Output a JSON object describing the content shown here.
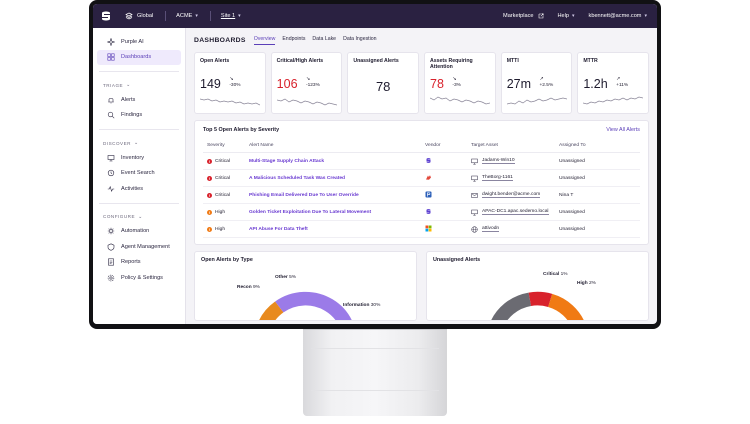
{
  "topbar": {
    "scope": "Global",
    "account": "ACME",
    "site": "Site 1",
    "marketplace": "Marketplace",
    "help": "Help",
    "user": "kbennett@acme.com"
  },
  "sidebar": {
    "items_top": [
      {
        "label": "Purple AI",
        "icon": "sparkle-icon"
      },
      {
        "label": "Dashboards",
        "icon": "dashboard-icon",
        "active": true
      }
    ],
    "sections": [
      {
        "title": "TRIAGE",
        "items": [
          {
            "label": "Alerts",
            "icon": "bell-icon"
          },
          {
            "label": "Findings",
            "icon": "findings-icon"
          }
        ]
      },
      {
        "title": "DISCOVER",
        "items": [
          {
            "label": "Inventory",
            "icon": "inventory-icon"
          },
          {
            "label": "Event Search",
            "icon": "search-icon"
          },
          {
            "label": "Activities",
            "icon": "activity-icon"
          }
        ]
      },
      {
        "title": "CONFIGURE",
        "items": [
          {
            "label": "Automation",
            "icon": "automation-icon"
          },
          {
            "label": "Agent Management",
            "icon": "agent-icon"
          },
          {
            "label": "Reports",
            "icon": "reports-icon"
          },
          {
            "label": "Policy & Settings",
            "icon": "gear-icon"
          }
        ]
      }
    ]
  },
  "dashboard": {
    "title": "DASHBOARDS",
    "tabs": [
      "Overview",
      "Endpoints",
      "Data Lake",
      "Data Ingestion"
    ],
    "active_tab": "Overview"
  },
  "metrics": [
    {
      "title": "Open Alerts",
      "value": "149",
      "trend": "-30%",
      "direction": "down",
      "color": "#1e1b2e"
    },
    {
      "title": "Critical/High Alerts",
      "value": "106",
      "trend": "-123%",
      "direction": "down",
      "color": "#d8222c"
    },
    {
      "title": "Unassigned Alerts",
      "value": "78",
      "trend": "",
      "direction": "",
      "color": "#1e1b2e"
    },
    {
      "title": "Assets Requiring Attention",
      "value": "78",
      "trend": "-3%",
      "direction": "down",
      "color": "#d8222c"
    },
    {
      "title": "MTTI",
      "value": "27m",
      "trend": "+2.5%",
      "direction": "up",
      "color": "#1e1b2e"
    },
    {
      "title": "MTTR",
      "value": "1.2h",
      "trend": "+11%",
      "direction": "up",
      "color": "#1e1b2e"
    }
  ],
  "top_alerts": {
    "title": "Top 5 Open Alerts by Severity",
    "link": "View All Alerts",
    "columns": [
      "Severity",
      "Alert Name",
      "Vendor",
      "Target Asset",
      "Assigned To"
    ],
    "rows": [
      {
        "severity": "Critical",
        "name": "Multi-Stage Supply Chain Attack",
        "vendor_color": "#5b3fd0",
        "asset_icon": "monitor-icon",
        "asset": "Jadams-Win10",
        "assigned": "Unassigned"
      },
      {
        "severity": "Critical",
        "name": "A Malicious Scheduled Task Was Created",
        "vendor_color": "#e2483b",
        "asset_icon": "monitor-icon",
        "asset": "TheBorg-1161",
        "assigned": "Unassigned"
      },
      {
        "severity": "Critical",
        "name": "Phishing Email Delivered Due To User Override",
        "vendor_color": "#2b5fb8",
        "asset_icon": "mail-icon",
        "asset": "dwight.bender@acme.com",
        "assigned": "Nina T"
      },
      {
        "severity": "High",
        "name": "Golden Ticket Exploitation Due To Lateral Movement",
        "vendor_color": "#5b3fd0",
        "asset_icon": "monitor-icon",
        "asset": "APAC-DC1.apac.sedemo.local",
        "assigned": "Unassigned"
      },
      {
        "severity": "High",
        "name": "API Abuse For Data Theft",
        "vendor_color": "#f25022",
        "asset_icon": "globe-icon",
        "asset": "attivodn",
        "assigned": "Unassigned"
      }
    ]
  },
  "chart_data": [
    {
      "type": "pie",
      "title": "Open Alerts by Type",
      "labels": [
        "Other",
        "Recon",
        "Information"
      ],
      "values": [
        5,
        9,
        30
      ],
      "value_labels": [
        "5%",
        "9%",
        "30%"
      ],
      "colors": [
        "#d8222c",
        "#e88a1e",
        "#9b7be8"
      ]
    },
    {
      "type": "pie",
      "title": "Unassigned Alerts",
      "labels": [
        "Critical",
        "High"
      ],
      "values": [
        1,
        2
      ],
      "value_labels": [
        "1%",
        "2%"
      ],
      "colors": [
        "#d8222c",
        "#f07a14"
      ]
    }
  ]
}
